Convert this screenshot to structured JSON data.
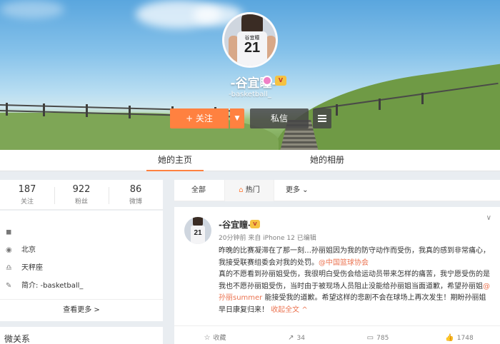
{
  "profile": {
    "name": "-谷宜瞳-",
    "subtitle": "-basketball_",
    "jersey_name": "谷宜瞳",
    "jersey_number": "21",
    "vip_badge": "V"
  },
  "actions": {
    "follow_label": "+ 关注",
    "follow_caret": "▼",
    "message_label": "私信"
  },
  "tabs": [
    {
      "label": "她的主页",
      "active": true
    },
    {
      "label": "她的相册",
      "active": false
    }
  ],
  "stats": [
    {
      "value": "187",
      "label": "关注"
    },
    {
      "value": "922",
      "label": "粉丝"
    },
    {
      "value": "86",
      "label": "微博"
    }
  ],
  "info": {
    "items": [
      {
        "icon": "level-icon",
        "glyph": "◼",
        "text": ""
      },
      {
        "icon": "location-icon",
        "glyph": "◉",
        "text": "北京"
      },
      {
        "icon": "zodiac-icon",
        "glyph": "♎",
        "text": "天秤座"
      },
      {
        "icon": "profile-icon",
        "glyph": "✎",
        "text": "简介: -basketball_"
      }
    ],
    "more_label": "查看更多 >"
  },
  "relations": {
    "title": "微关系"
  },
  "filter": {
    "all": "全部",
    "hot": "热门",
    "more": "更多 ⌄"
  },
  "post": {
    "author": "-谷宜瞳-",
    "vip_badge": "V",
    "meta": "20分钟前 来自 iPhone 12   已编辑",
    "caret": "∨",
    "para1_a": "昨晚的比赛凝滞在了那一刻…孙丽姐因为我的防守动作而受伤，我真的感到非常痛心，我接受联赛组委会对我的处罚。",
    "para1_link": "@中国篮球协会",
    "para2_a": "真的不愿看到孙丽姐受伤，我很明白受伤会给运动员带来怎样的痛苦，我宁愿受伤的是我也不愿孙丽姐受伤，当时由于被现场人员阻止没能给孙丽姐当面道歉，希望孙丽姐",
    "para2_link": "@孙丽summer",
    "para2_b": " 能接受我的道歉。希望这样的悲剧不会在球场上再次发生！期盼孙丽姐早日康复归来！",
    "collapse_label": "收起全文 ^",
    "actions": {
      "favorite": "收藏",
      "repost": "34",
      "comment": "785",
      "like": "1748"
    }
  }
}
